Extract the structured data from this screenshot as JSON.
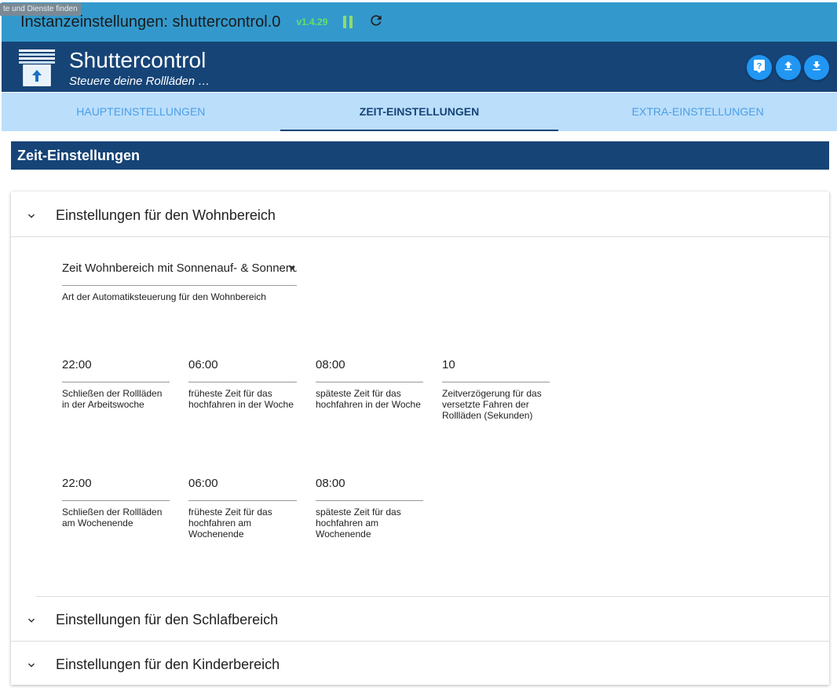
{
  "tooltip": "te und Dienste finden",
  "titlebar": {
    "title": "Instanzeinstellungen: shuttercontrol.0",
    "version": "v1.4.29"
  },
  "header": {
    "title": "Shuttercontrol",
    "subtitle": "Steuere deine Rollläden …"
  },
  "tabs": [
    {
      "label": "HAUPTEINSTELLUNGEN"
    },
    {
      "label": "ZEIT-EINSTELLUNGEN"
    },
    {
      "label": "EXTRA-EINSTELLUNGEN"
    }
  ],
  "section_title": "Zeit-Einstellungen",
  "accordions": [
    {
      "label": "Einstellungen für den Wohnbereich"
    },
    {
      "label": "Einstellungen für den Schlafbereich"
    },
    {
      "label": "Einstellungen für den Kinderbereich"
    }
  ],
  "wohnbereich": {
    "mode_value": "Zeit Wohnbereich mit Sonnenauf- & Sonnenuntergang",
    "mode_help": "Art der Automatiksteuerung für den Wohnbereich",
    "week": [
      {
        "value": "22:00",
        "help": "Schließen der Rollläden in der Arbeitswoche"
      },
      {
        "value": "06:00",
        "help": "früheste Zeit für das hochfahren in der Woche"
      },
      {
        "value": "08:00",
        "help": "späteste Zeit für das hochfahren in der Woche"
      },
      {
        "value": "10",
        "help": "Zeitverzögerung für das versetzte Fahren der Rollläden (Sekunden)"
      }
    ],
    "weekend": [
      {
        "value": "22:00",
        "help": "Schließen der Rollläden am Wochenende"
      },
      {
        "value": "06:00",
        "help": "früheste Zeit für das hochfahren am Wochenende"
      },
      {
        "value": "08:00",
        "help": "späteste Zeit für das hochfahren am Wochenende"
      }
    ]
  },
  "icons": {
    "pause": "pause-icon",
    "reload": "reload-icon",
    "help": "help-icon",
    "upload": "upload-icon",
    "download": "download-icon",
    "chevron": "chevron-down-icon"
  },
  "colors": {
    "titlebar": "#3399cc",
    "header": "#164477",
    "tabs_bg": "#bbdefb",
    "button": "#2196f3",
    "version": "#66e066"
  }
}
